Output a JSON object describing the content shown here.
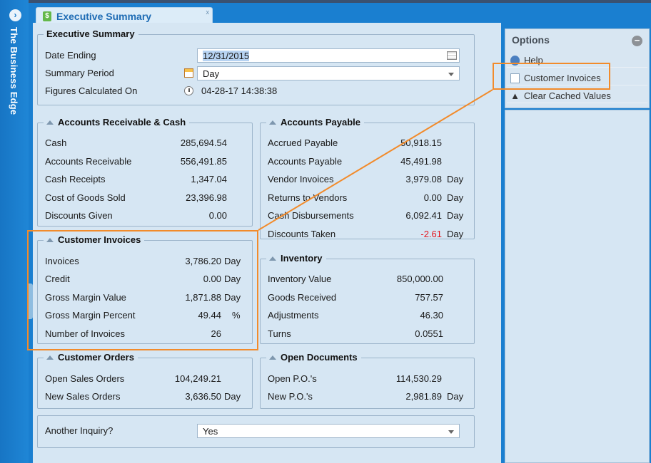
{
  "sidebar": {
    "title": "The Business Edge"
  },
  "tab": {
    "label": "Executive Summary",
    "close": "x"
  },
  "header": {
    "title": "Executive Summary",
    "date_ending_label": "Date Ending",
    "date_ending_value": "12/31/2015",
    "summary_period_label": "Summary Period",
    "summary_period_value": "Day",
    "figures_label": "Figures Calculated On",
    "figures_value": "04-28-17 14:38:38"
  },
  "ar": {
    "title": "Accounts Receivable & Cash",
    "rows": [
      {
        "label": "Cash",
        "value": "285,694.54"
      },
      {
        "label": "Accounts Receivable",
        "value": "556,491.85"
      },
      {
        "label": "Cash Receipts",
        "value": "1,347.04"
      },
      {
        "label": "Cost of Goods Sold",
        "value": "23,396.98"
      },
      {
        "label": "Discounts Given",
        "value": "0.00"
      }
    ]
  },
  "ap": {
    "title": "Accounts Payable",
    "rows": [
      {
        "label": "Accrued Payable",
        "value": "50,918.15",
        "unit": ""
      },
      {
        "label": "Accounts Payable",
        "value": "45,491.98",
        "unit": ""
      },
      {
        "label": "Vendor Invoices",
        "value": "3,979.08",
        "unit": "Day"
      },
      {
        "label": "Returns to Vendors",
        "value": "0.00",
        "unit": "Day"
      },
      {
        "label": "Cash Disbursements",
        "value": "6,092.41",
        "unit": "Day"
      },
      {
        "label": "Discounts Taken",
        "value": "-2.61",
        "unit": "Day"
      }
    ]
  },
  "ci": {
    "title": "Customer Invoices",
    "rows": [
      {
        "label": "Invoices",
        "value": "3,786.20",
        "unit": "Day"
      },
      {
        "label": "Credit",
        "value": "0.00",
        "unit": "Day"
      },
      {
        "label": "Gross Margin Value",
        "value": "1,871.88",
        "unit": "Day"
      },
      {
        "label": "Gross Margin Percent",
        "value": "49.44",
        "unit": "%"
      },
      {
        "label": "Number of Invoices",
        "value": "26",
        "unit": ""
      }
    ]
  },
  "inv": {
    "title": "Inventory",
    "rows": [
      {
        "label": "Inventory Value",
        "value": "850,000.00"
      },
      {
        "label": "Goods Received",
        "value": "757.57"
      },
      {
        "label": "Adjustments",
        "value": "46.30"
      },
      {
        "label": "Turns",
        "value": "0.0551"
      }
    ]
  },
  "co": {
    "title": "Customer Orders",
    "rows": [
      {
        "label": "Open Sales Orders",
        "value": "104,249.21",
        "unit": ""
      },
      {
        "label": "New Sales Orders",
        "value": "3,636.50",
        "unit": "Day"
      }
    ]
  },
  "od": {
    "title": "Open Documents",
    "rows": [
      {
        "label": "Open P.O.'s",
        "value": "114,530.29",
        "unit": ""
      },
      {
        "label": "New P.O.'s",
        "value": "2,981.89",
        "unit": "Day"
      }
    ]
  },
  "inquiry": {
    "label": "Another Inquiry?",
    "value": "Yes"
  },
  "options": {
    "title": "Options",
    "items": [
      {
        "label": "Help",
        "icon": "help-icon"
      },
      {
        "label": "Customer Invoices",
        "icon": "document-icon"
      },
      {
        "label": "Clear Cached Values",
        "icon": "penguin-icon"
      }
    ]
  },
  "colors": {
    "accent": "#1a7fd0",
    "panel": "#d6e6f3",
    "highlight": "#f28b2b",
    "negative": "#e4141c"
  }
}
